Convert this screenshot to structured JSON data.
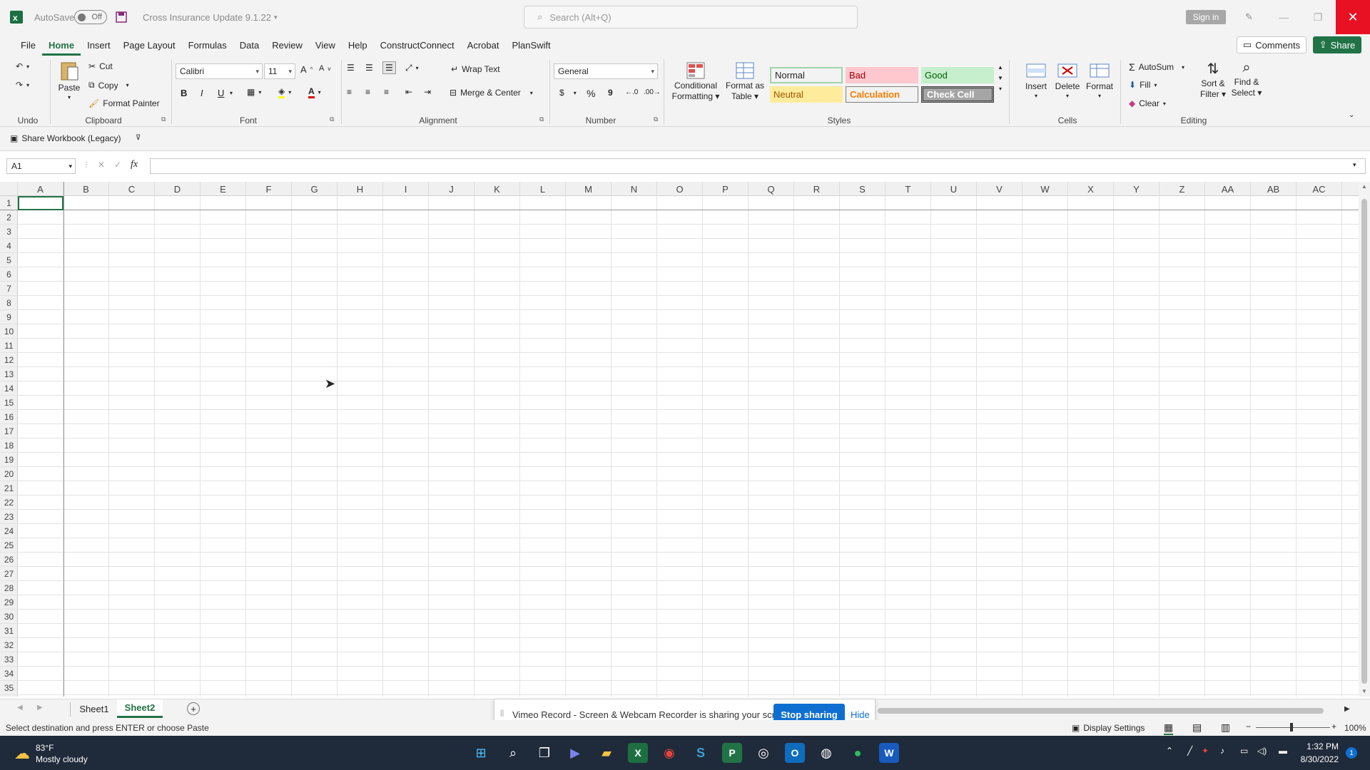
{
  "titlebar": {
    "autosave_label": "AutoSave",
    "autosave_state": "Off",
    "doc_title": "Cross Insurance Update 9.1.22",
    "search_placeholder": "Search (Alt+Q)",
    "signin_label": "Sign in",
    "close_glyph": "✕",
    "min_glyph": "—",
    "restore_glyph": "❐"
  },
  "menu": {
    "tabs": [
      "File",
      "Home",
      "Insert",
      "Page Layout",
      "Formulas",
      "Data",
      "Review",
      "View",
      "Help",
      "ConstructConnect",
      "Acrobat",
      "PlanSwift"
    ],
    "active_index": 1,
    "comments_label": "Comments",
    "share_label": "Share"
  },
  "ribbon": {
    "undo_label": "Undo",
    "clipboard": {
      "paste": "Paste",
      "cut": "Cut",
      "copy": "Copy",
      "format_painter": "Format Painter",
      "group": "Clipboard"
    },
    "font": {
      "name": "Calibri",
      "size": "11",
      "group": "Font",
      "bold": "B",
      "italic": "I",
      "underline": "U"
    },
    "alignment": {
      "wrap_text": "Wrap Text",
      "merge_center": "Merge & Center",
      "group": "Alignment"
    },
    "number": {
      "format": "General",
      "currency": "$",
      "percent": "%",
      "comma": "9",
      "group": "Number"
    },
    "styles_buttons": {
      "conditional": [
        "Conditional",
        "Formatting"
      ],
      "format_table": [
        "Format as",
        "Table"
      ],
      "group": "Styles"
    },
    "styles": [
      {
        "name": "Normal",
        "bg": "#ffffff",
        "fg": "#000000"
      },
      {
        "name": "Bad",
        "bg": "#ffc7ce",
        "fg": "#9c0006"
      },
      {
        "name": "Good",
        "bg": "#c6efce",
        "fg": "#006100"
      },
      {
        "name": "Neutral",
        "bg": "#ffeb9c",
        "fg": "#9c5700"
      },
      {
        "name": "Calculation",
        "bg": "#f2f2f2",
        "fg": "#fa7d00"
      },
      {
        "name": "Check Cell",
        "bg": "#a5a5a5",
        "fg": "#ffffff"
      }
    ],
    "cells": {
      "insert": "Insert",
      "delete": "Delete",
      "format": "Format",
      "group": "Cells"
    },
    "editing": {
      "autosum": "AutoSum",
      "fill": "Fill",
      "clear": "Clear",
      "sort_filter": [
        "Sort &",
        "Filter"
      ],
      "find_select": [
        "Find &",
        "Select"
      ],
      "group": "Editing"
    }
  },
  "share_workbook_label": "Share Workbook (Legacy)",
  "formula_bar": {
    "name_box": "A1",
    "fx": "fx"
  },
  "grid": {
    "columns": [
      "A",
      "B",
      "C",
      "D",
      "E",
      "F",
      "G",
      "H",
      "I",
      "J",
      "K",
      "L",
      "M",
      "N",
      "O",
      "P",
      "Q",
      "R",
      "S",
      "T",
      "U",
      "V",
      "W",
      "X",
      "Y",
      "Z",
      "AA",
      "AB",
      "AC"
    ],
    "rows": [
      "1",
      "2",
      "3",
      "4",
      "5",
      "6",
      "7",
      "8",
      "9",
      "10",
      "11",
      "12",
      "13",
      "14",
      "15",
      "16",
      "17",
      "18",
      "19",
      "20",
      "21",
      "22",
      "23",
      "24",
      "25",
      "26",
      "27",
      "28",
      "29",
      "30",
      "31",
      "32",
      "33",
      "34",
      "35"
    ]
  },
  "sheets": {
    "tabs": [
      "Sheet1",
      "Sheet2"
    ],
    "active_index": 1
  },
  "vimeo": {
    "message": "Vimeo Record - Screen & Webcam Recorder is sharing your screen.",
    "stop_label": "Stop sharing",
    "hide_label": "Hide"
  },
  "statusbar": {
    "message": "Select destination and press ENTER or choose Paste",
    "display_settings": "Display Settings",
    "zoom": "100%"
  },
  "taskbar": {
    "temperature": "83°F",
    "weather": "Mostly cloudy",
    "time": "1:32 PM",
    "date": "8/30/2022"
  },
  "colors": {
    "accent": "#217346",
    "close": "#e81123",
    "taskbar": "#1f2a3a"
  }
}
